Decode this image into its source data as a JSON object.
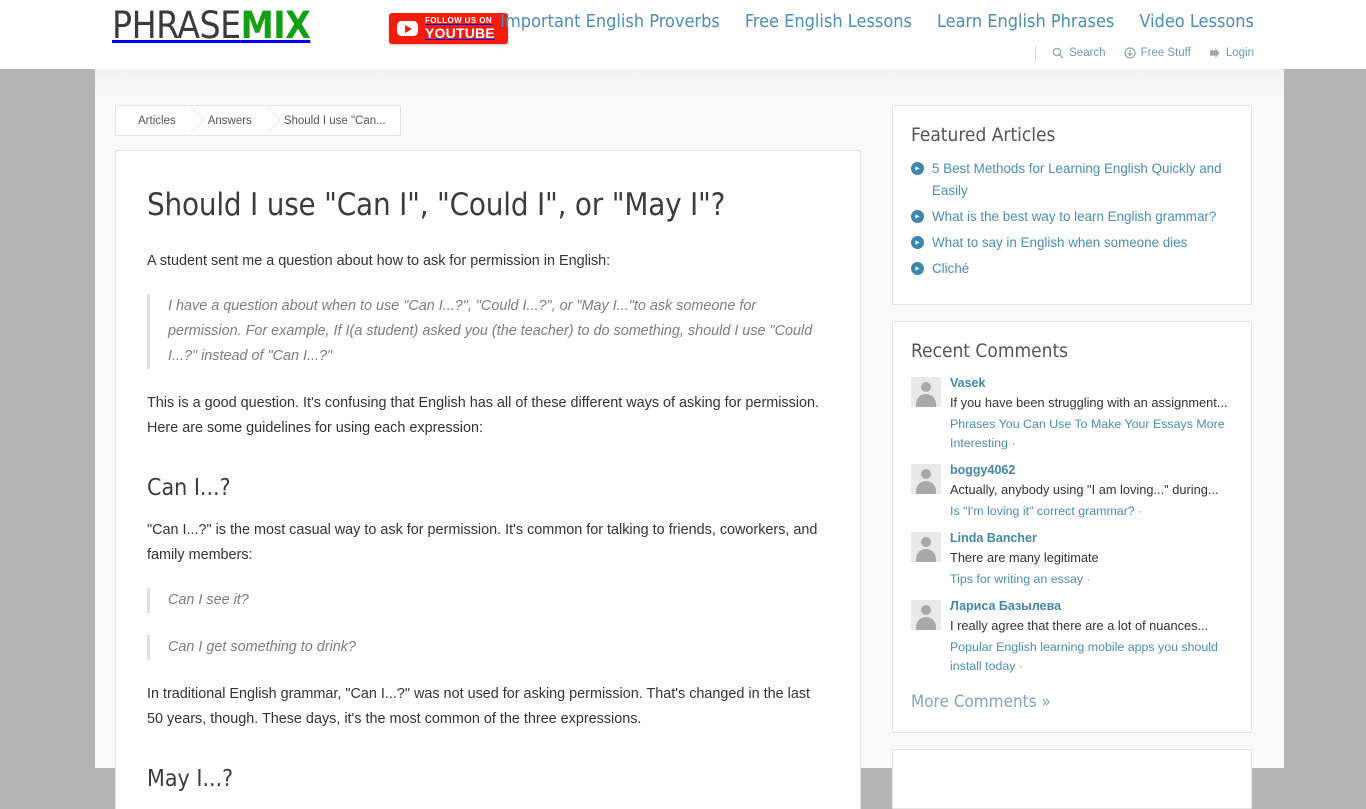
{
  "header": {
    "logo": {
      "part1": "PHRASE",
      "part2": "MIX"
    },
    "youtube_badge": {
      "line1": "FOLLOW US ON",
      "line2": "YOUTUBE",
      "color": "#f61c0d",
      "icon": "youtube-play-icon"
    },
    "nav": [
      {
        "label": "Important English Proverbs"
      },
      {
        "label": "Free English Lessons"
      },
      {
        "label": "Learn English Phrases"
      },
      {
        "label": "Video Lessons"
      }
    ],
    "subnav": [
      {
        "label": "Search",
        "icon": "search-icon"
      },
      {
        "label": "Free Stuff",
        "icon": "download-circle-icon"
      },
      {
        "label": "Login",
        "icon": "login-arrow-icon"
      }
    ],
    "link_color": "#4a8db7"
  },
  "breadcrumb": [
    {
      "label": "Articles"
    },
    {
      "label": "Answers"
    },
    {
      "label": "Should I use \"Can..."
    }
  ],
  "article": {
    "title": "Should I use \"Can I\", \"Could I\", or \"May I\"?",
    "intro": "A student sent me a question about how to ask for permission in English:",
    "quote": "I have a question about when to use \"Can I...?\", \"Could I...?\", or \"May I...\"to ask someone for permission. For example, If I(a student) asked you (the teacher) to do something, should I use \"Could I...?\" instead of \"Can I...?\"",
    "paragraph_2": "This is a good question. It's confusing that English has all of these different ways of asking for permission. Here are some guidelines for using each expression:",
    "section1_heading": "Can I...?",
    "section1_paragraph": "\"Can I...?\" is the most casual way to ask for permission. It's common for talking to friends, coworkers, and family members:",
    "example_1": "Can I see it?",
    "example_2": "Can I get something to drink?",
    "section1_paragraph_2": "In traditional English grammar, \"Can I...?\" was not used for asking permission. That's changed in the last 50 years, though. These days, it's the most common of the three expressions.",
    "section2_heading": "May I...?"
  },
  "sidebar": {
    "featured": {
      "title": "Featured Articles",
      "items": [
        {
          "label": "5 Best Methods for Learning English Quickly and Easily"
        },
        {
          "label": "What is the best way to learn English grammar?"
        },
        {
          "label": "What to say in English when someone dies"
        },
        {
          "label": "Cliché"
        }
      ]
    },
    "recent_comments": {
      "title": "Recent Comments",
      "more_label": "More Comments »",
      "items": [
        {
          "author": "Vasek",
          "snippet": "If you have been struggling with an assignment...",
          "context": "Phrases You Can Use To Make Your Essays More Interesting",
          "separator": "·"
        },
        {
          "author": "boggy4062",
          "snippet": "Actually, anybody using \"I am loving...\" during...",
          "context": "Is \"I'm loving it\" correct grammar?",
          "separator": "·"
        },
        {
          "author": "Linda Bancher",
          "snippet": "There are many legitimate",
          "context": "Tips for writing an essay",
          "separator": "·"
        },
        {
          "author": "Лариса Базылева",
          "snippet": "I really agree that there are a lot of nuances...",
          "context": "Popular English learning mobile apps you should install today",
          "separator": "·"
        }
      ]
    }
  },
  "theme": {
    "page_background": "#b4b4b4",
    "content_background": "#fafafa",
    "accent": "#4a8db7",
    "logo_green": "#12a112"
  }
}
